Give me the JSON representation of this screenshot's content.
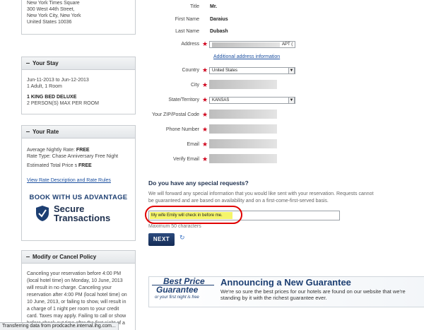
{
  "address": {
    "lines": [
      "New York Times Square",
      "300 West 44th Street,",
      "New York City, New York",
      "United States  10036"
    ]
  },
  "your_stay": {
    "title": "Your Stay",
    "dates": "Jun-11-2013 to  Jun-12-2013",
    "guests": "1 Adult, 1 Room",
    "room_type": "1 KING BED DELUXE",
    "occupancy": "2 PERSON(S) MAX PER ROOM"
  },
  "your_rate": {
    "title": "Your Rate",
    "avg_label": "Average Nightly Rate: ",
    "avg_value": "FREE",
    "rate_type": "Rate Type: Chase Anniversary Free Night",
    "total_label": "Estimated Total Price ",
    "total_suffix": "s ",
    "total_value": "FREE",
    "link": "View Rate Description and Rate Rules"
  },
  "advantage": {
    "title": "BOOK WITH US ADVANTAGE",
    "line1": "Secure",
    "line2": "Transactions"
  },
  "policy": {
    "title": "Modify or Cancel Policy",
    "text": "Canceling your reservation before 4:00 PM (local hotel time) on Monday, 10 June, 2013 will result in no charge. Canceling your reservation after 4:00 PM (local hotel time) on 10 June, 2013, or failing to show, will result in a charge of 1 night per room to your credit card. Taxes may apply. Failing to call or show before check-out time after the first night of a"
  },
  "form": {
    "title_label": "Title",
    "title_value": "Mr.",
    "first_label": "First Name",
    "first_value": "Daraius",
    "last_label": "Last Name",
    "last_value": "Dubash",
    "address_label": "Address",
    "address_suffix": "APT (",
    "additional_link": "Additional address information",
    "country_label": "Country",
    "country_value": "United States",
    "city_label": "City",
    "state_label": "State/Territory",
    "state_value": "KANSAS",
    "zip_label": "Your ZIP/Postal Code",
    "phone_label": "Phone Number",
    "email_label": "Email",
    "verify_label": "Verify Email"
  },
  "requests": {
    "title": "Do you have any special requests?",
    "text": "We will forward any special information that you would like sent with your reservation. Requests cannot be guaranteed and are based on availability and on a first-come-first-served basis.",
    "value": "My wife Emily will check in before me.",
    "max": "Maximum 50 characters",
    "next": "NEXT"
  },
  "banner": {
    "logo_line1": "Best Price",
    "logo_line2": "Guarantee",
    "logo_tag": "or your first night is free",
    "title": "Announcing a New Guarantee",
    "text": "We're so sure the best prices for our hotels are found on our website that we're standing by it with the richest guarantee ever."
  },
  "status_bar": "Transferring data from prodcache.internal.ihg.com..."
}
